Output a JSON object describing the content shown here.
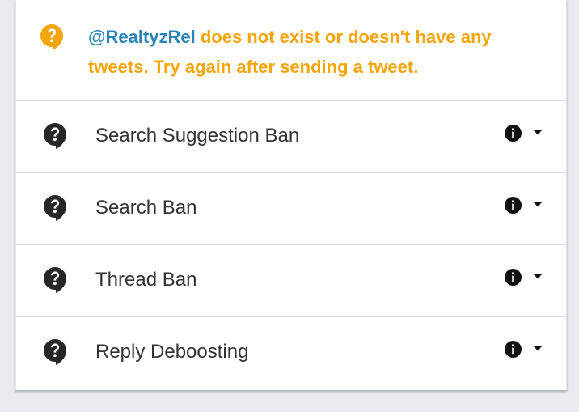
{
  "notice": {
    "icon": "question-bubble-icon",
    "handle": "@RealtyzRel",
    "message": " does not exist or doesn't have any tweets. Try again after sending a tweet.",
    "handle_color": "#2a84b8",
    "message_color": "#f4a50a"
  },
  "checks": [
    {
      "label": "Search Suggestion Ban",
      "status_icon": "question-bubble-icon",
      "info_icon": "info-icon",
      "toggle_icon": "caret-down-icon"
    },
    {
      "label": "Search Ban",
      "status_icon": "question-bubble-icon",
      "info_icon": "info-icon",
      "toggle_icon": "caret-down-icon"
    },
    {
      "label": "Thread Ban",
      "status_icon": "question-bubble-icon",
      "info_icon": "info-icon",
      "toggle_icon": "caret-down-icon"
    },
    {
      "label": "Reply Deboosting",
      "status_icon": "question-bubble-icon",
      "info_icon": "info-icon",
      "toggle_icon": "caret-down-icon"
    }
  ]
}
